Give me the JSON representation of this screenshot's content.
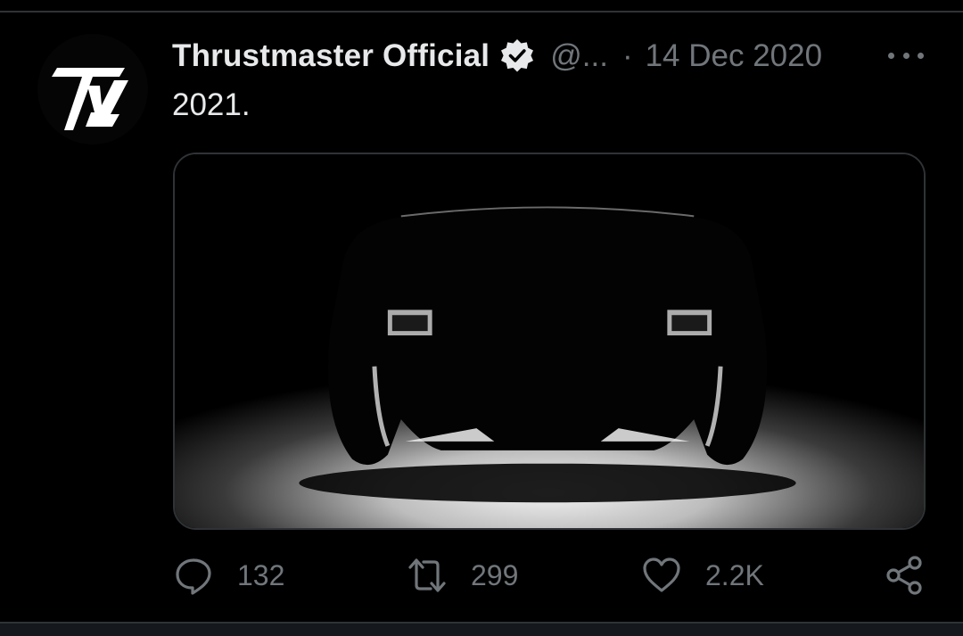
{
  "tweet": {
    "author": {
      "display_name": "Thrustmaster Official",
      "handle": "@...",
      "avatar_icon": "thrustmaster-logo-icon",
      "verified_icon": "verified-badge-icon"
    },
    "separator": "·",
    "date": "14 Dec 2020",
    "more_icon": "more-options-icon",
    "text": "2021.",
    "media": {
      "description_icon": "steering-wheel-silhouette-image"
    },
    "actions": {
      "reply": {
        "icon": "reply-icon",
        "count": "132"
      },
      "retweet": {
        "icon": "retweet-icon",
        "count": "299"
      },
      "like": {
        "icon": "heart-icon",
        "count": "2.2K"
      },
      "share": {
        "icon": "share-icon"
      }
    }
  },
  "colors": {
    "background": "#000000",
    "primary_text": "#e7e9ea",
    "secondary_text": "#71767b",
    "border": "#2f3336"
  }
}
